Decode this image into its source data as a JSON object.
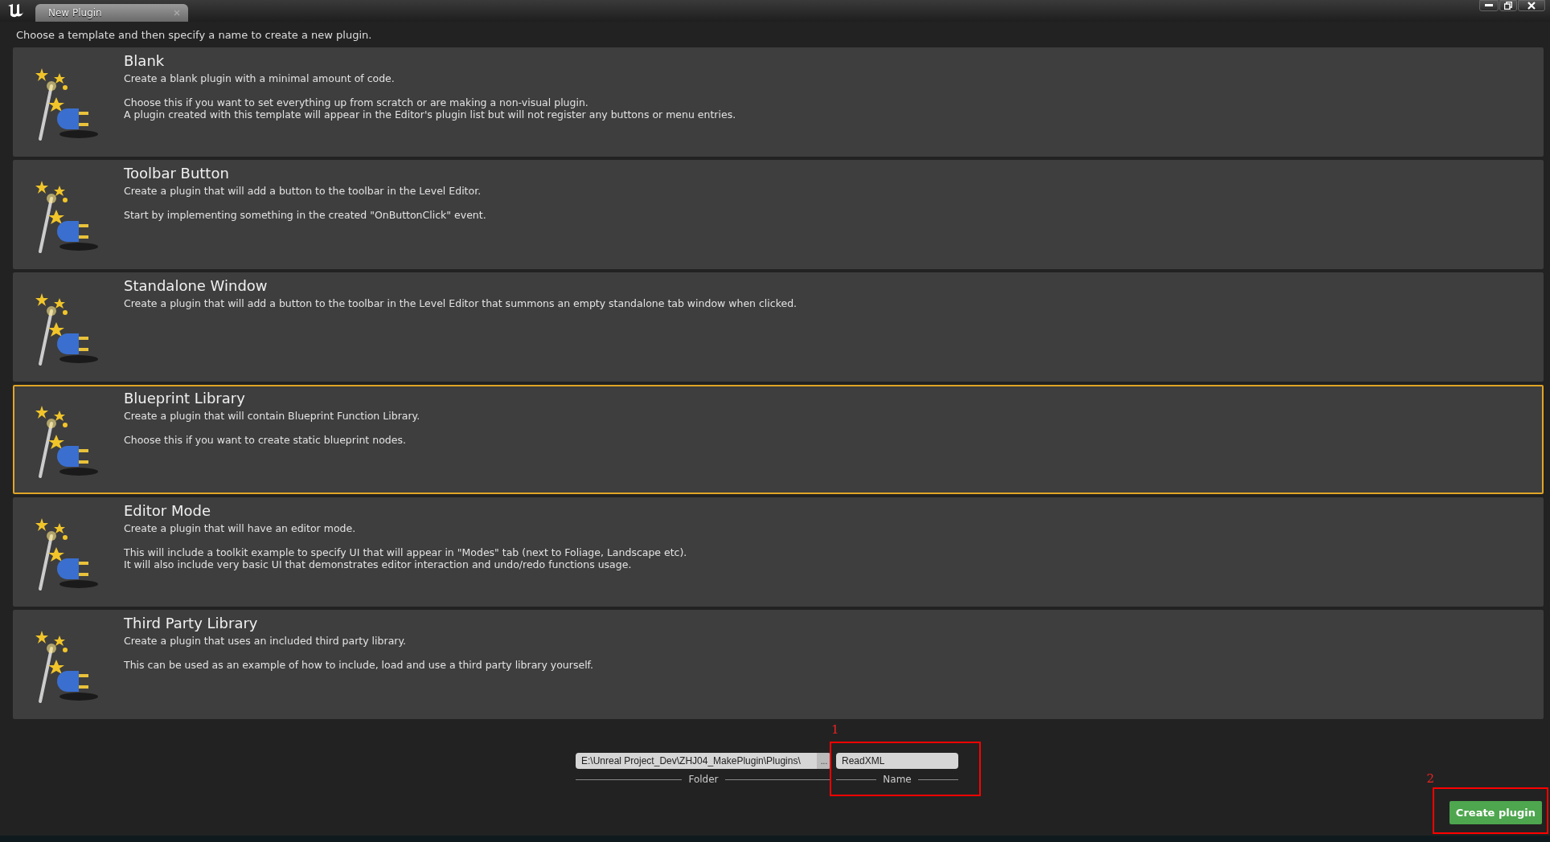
{
  "window": {
    "tab_title": "New Plugin"
  },
  "instructions": "Choose a template and then specify a name to create a new plugin.",
  "templates": [
    {
      "title": "Blank",
      "paragraphs": [
        [
          "Create a blank plugin with a minimal amount of code."
        ],
        [
          "Choose this if you want to set everything up from scratch or are making a non-visual plugin.",
          "A plugin created with this template will appear in the Editor's plugin list but will not register any buttons or menu entries."
        ]
      ],
      "selected": false
    },
    {
      "title": "Toolbar Button",
      "paragraphs": [
        [
          "Create a plugin that will add a button to the toolbar in the Level Editor."
        ],
        [
          "Start by implementing something in the created \"OnButtonClick\" event."
        ]
      ],
      "selected": false
    },
    {
      "title": "Standalone Window",
      "paragraphs": [
        [
          "Create a plugin that will add a button to the toolbar in the Level Editor that summons an empty standalone tab window when clicked."
        ]
      ],
      "selected": false
    },
    {
      "title": "Blueprint Library",
      "paragraphs": [
        [
          "Create a plugin that will contain Blueprint Function Library."
        ],
        [
          "Choose this if you want to create static blueprint nodes."
        ]
      ],
      "selected": true
    },
    {
      "title": "Editor Mode",
      "paragraphs": [
        [
          "Create a plugin that will have an editor mode."
        ],
        [
          "This will include a toolkit example to specify UI that will appear in \"Modes\" tab (next to Foliage, Landscape etc).",
          "It will also include very basic UI that demonstrates editor interaction and undo/redo functions usage."
        ]
      ],
      "selected": false
    },
    {
      "title": "Third Party Library",
      "paragraphs": [
        [
          "Create a plugin that uses an included third party library."
        ],
        [
          "This can be used as an example of how to include, load and use a third party library yourself."
        ]
      ],
      "selected": false
    }
  ],
  "folder": {
    "value": "E:\\Unreal Project_Dev\\ZHJ04_MakePlugin\\Plugins\\",
    "browse": "...",
    "label": "Folder"
  },
  "name": {
    "value": "ReadXML",
    "label": "Name"
  },
  "create_button": "Create plugin",
  "annotations": [
    "1",
    "2"
  ]
}
